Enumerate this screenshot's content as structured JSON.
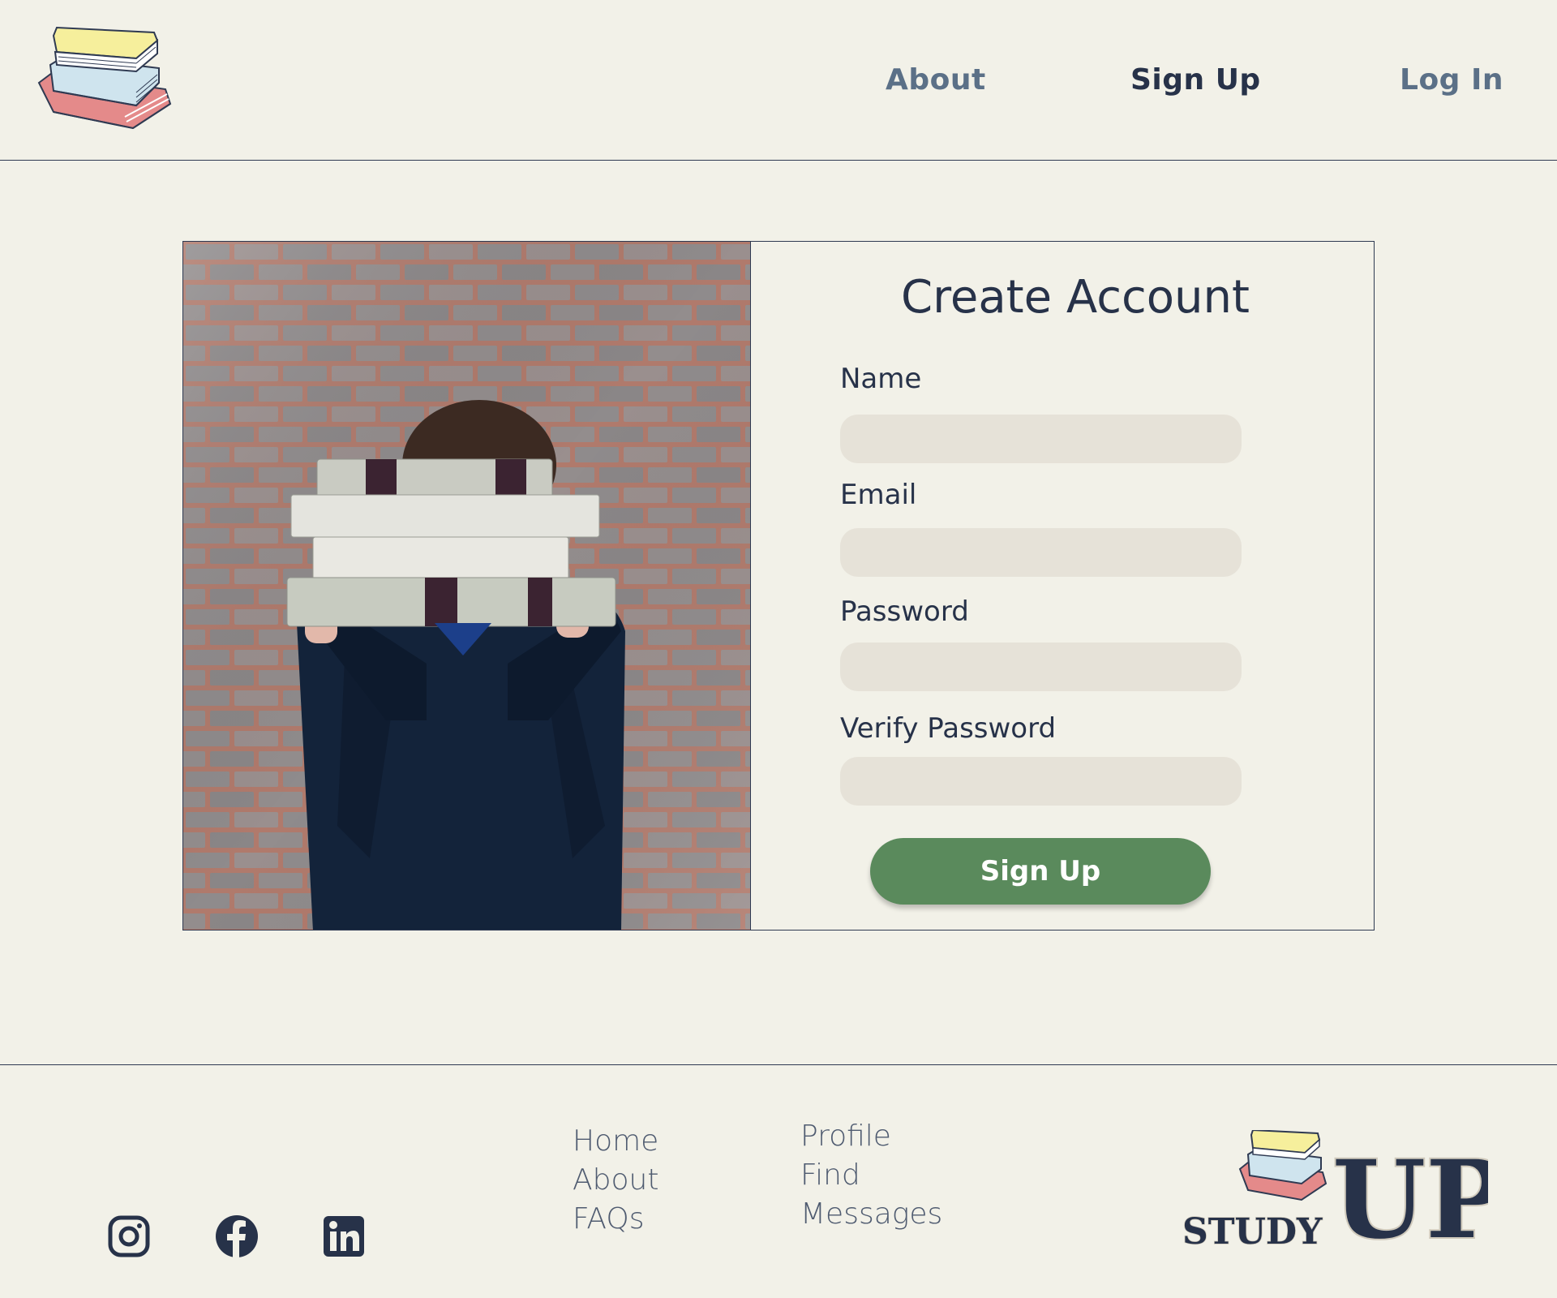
{
  "header": {
    "nav": {
      "about": "About",
      "signup": "Sign Up",
      "login": "Log In"
    }
  },
  "form": {
    "title": "Create Account",
    "fields": [
      {
        "label": "Name",
        "value": "",
        "placeholder": ""
      },
      {
        "label": "Email",
        "value": "",
        "placeholder": ""
      },
      {
        "label": "Password",
        "value": "",
        "placeholder": ""
      },
      {
        "label": "Verify Password",
        "value": "",
        "placeholder": ""
      }
    ],
    "submit_label": "Sign Up"
  },
  "footer": {
    "social": [
      "instagram-icon",
      "facebook-icon",
      "linkedin-icon"
    ],
    "links_col1": [
      "Home",
      "About",
      "FAQs"
    ],
    "links_col2": [
      "Profile",
      "Find",
      "Messages"
    ],
    "brand": {
      "small": "STUDY",
      "big": "UP"
    }
  },
  "colors": {
    "background": "#f2f1e8",
    "navy": "#273249",
    "nav_muted": "#5b7087",
    "input_bg": "#e6e2d8",
    "button_green": "#5a8a5c",
    "book_yellow": "#f6ef9c",
    "book_blue": "#cfe4ee",
    "book_red": "#e48a8a"
  }
}
